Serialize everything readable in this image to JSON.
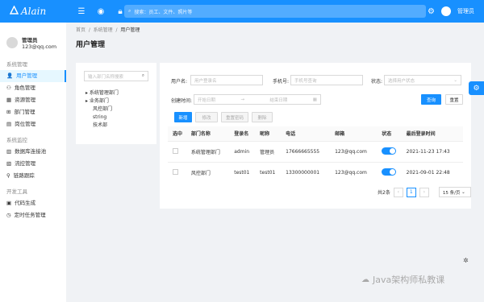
{
  "header": {
    "brand": "Alain",
    "search_placeholder": "搜索：员工、文件、照片等",
    "username": "管理员"
  },
  "sidebar": {
    "user_name": "管理员",
    "user_email": "123@qq.com",
    "groups": [
      {
        "title": "系统管理",
        "items": [
          {
            "label": "用户管理",
            "icon": "👤",
            "active": true
          },
          {
            "label": "角色管理",
            "icon": "⚇"
          },
          {
            "label": "资源管理",
            "icon": "▦"
          },
          {
            "label": "部门管理",
            "icon": "⊞"
          },
          {
            "label": "岗位管理",
            "icon": "▤"
          }
        ]
      },
      {
        "title": "系统监控",
        "items": [
          {
            "label": "数据库连接池",
            "icon": "▥"
          },
          {
            "label": "流控管理",
            "icon": "▧"
          },
          {
            "label": "链路跟踪",
            "icon": "⚲"
          }
        ]
      },
      {
        "title": "开发工具",
        "items": [
          {
            "label": "代码生成",
            "icon": "▣"
          },
          {
            "label": "定时任务管理",
            "icon": "◷"
          }
        ]
      }
    ]
  },
  "breadcrumb": [
    "首页",
    "系统管理",
    "用户管理"
  ],
  "page_title": "用户管理",
  "tree": {
    "search_placeholder": "输入部门名称搜索",
    "nodes": [
      {
        "label": "系统管理部门",
        "expandable": true
      },
      {
        "label": "业务部门",
        "expandable": true
      },
      {
        "label": "风控部门",
        "expandable": false
      },
      {
        "label": "string",
        "expandable": false
      },
      {
        "label": "技术部",
        "expandable": false
      }
    ]
  },
  "filters": {
    "username_label": "用户名:",
    "username_placeholder": "用户登录名",
    "phone_label": "手机号:",
    "phone_placeholder": "手机号查询",
    "status_label": "状态:",
    "status_placeholder": "选择用户状态",
    "created_label": "创建时间:",
    "start_placeholder": "开始日期",
    "end_placeholder": "结束日期",
    "query": "查询",
    "reset": "重置"
  },
  "actions": {
    "add": "新增",
    "edit": "修改",
    "reset_pwd": "重置密码",
    "delete": "删除"
  },
  "table": {
    "headers": [
      "选中",
      "部门名称",
      "登录名",
      "昵称",
      "电话",
      "邮箱",
      "状态",
      "最后登录时间"
    ],
    "rows": [
      {
        "dept": "系统管理部门",
        "login": "admin",
        "nick": "管理员",
        "phone": "17666665555",
        "email": "123@qq.com",
        "status": true,
        "last_login": "2021-11-23 17:43"
      },
      {
        "dept": "风控部门",
        "login": "test01",
        "nick": "test01",
        "phone": "13300000001",
        "email": "123@qq.com",
        "status": true,
        "last_login": "2021-09-01 22:48"
      }
    ]
  },
  "pagination": {
    "total_text": "共2条",
    "current": "1",
    "page_size": "15 条/页"
  },
  "watermark": "Java架构师私教课",
  "colors": {
    "primary": "#1890ff"
  }
}
